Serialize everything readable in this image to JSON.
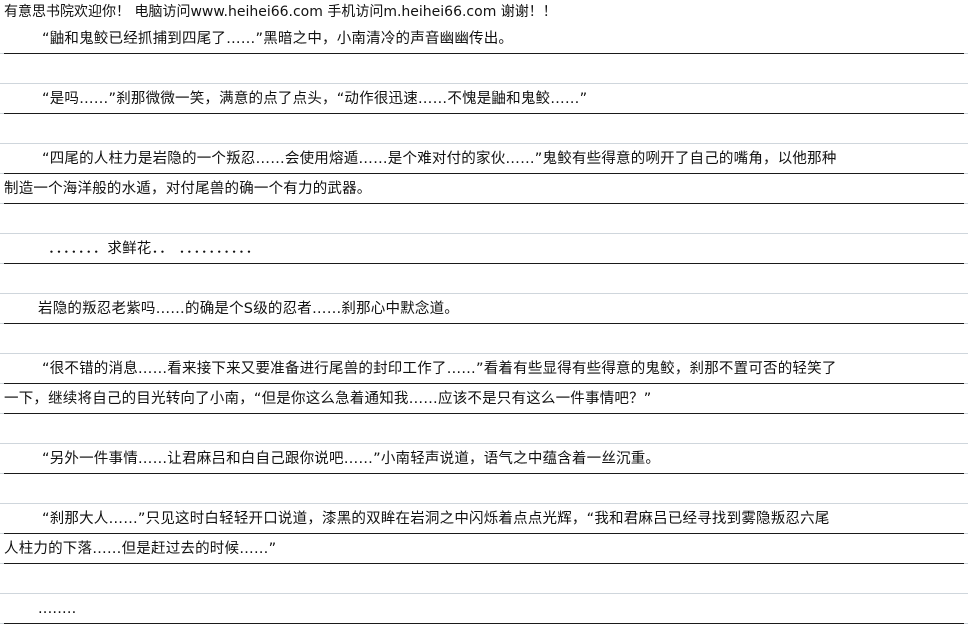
{
  "header": {
    "text": "有意思书院欢迎你！ 电脑访问www.heihei66.com 手机访问m.heihei66.com 谢谢！！"
  },
  "lines": [
    "“鼬和鬼鲛已经抓捕到四尾了……”黑暗之中，小南清冷的声音幽幽传出。",
    "“是吗……”刹那微微一笑，满意的点了点头，“动作很迅速……不愧是鼬和鬼鲛……”",
    "“四尾的人柱力是岩隐的一个叛忍……会使用熔遁……是个难对付的家伙……”鬼鲛有些得意的咧开了自己的嘴角，以他那种",
    "制造一个海洋般的水遁，对付尾兽的确一个有力的武器。",
    "．．．．．．．求鲜花．．  ．．．．．．．．．．",
    "岩隐的叛忍老紫吗……的确是个S级的忍者……刹那心中默念道。",
    "“很不错的消息……看来接下来又要准备进行尾兽的封印工作了……”看着有些显得有些得意的鬼鲛，刹那不置可否的轻笑了",
    "一下，继续将自己的目光转向了小南，“但是你这么急着通知我……应该不是只有这么一件事情吧？”",
    "“另外一件事情……让君麻吕和白自己跟你说吧……”小南轻声说道，语气之中蕴含着一丝沉重。",
    "“刹那大人……”只见这时白轻轻开口说道，漆黑的双眸在岩洞之中闪烁着点点光辉，“我和君麻吕已经寻找到雾隐叛忍六尾",
    "人柱力的下落……但是赶过去的时候……”",
    "........"
  ]
}
